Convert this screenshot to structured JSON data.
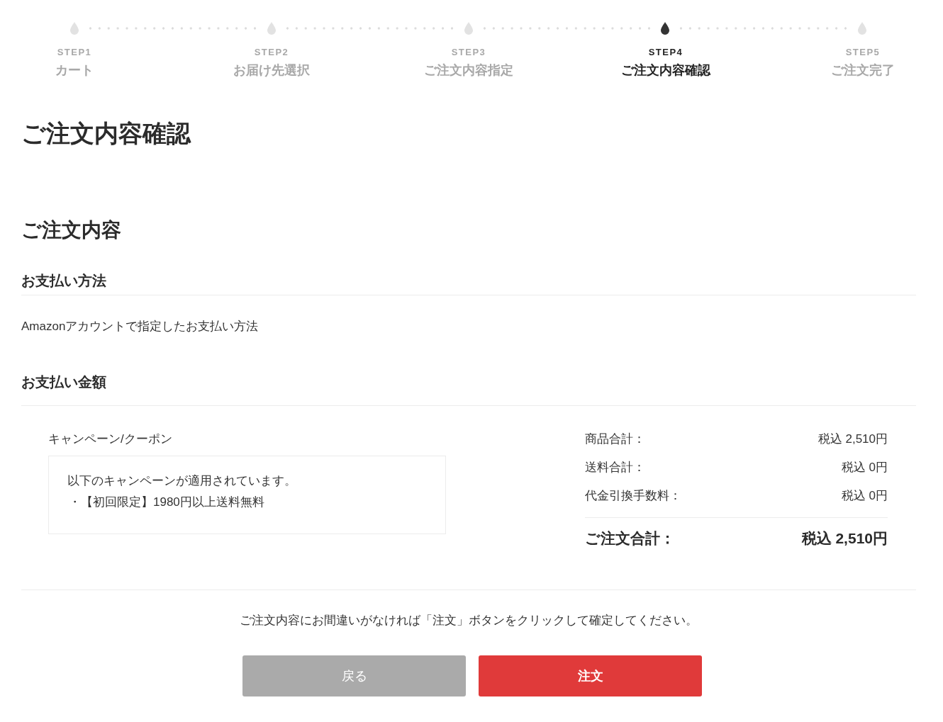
{
  "progress": {
    "steps": [
      {
        "label": "STEP1",
        "title": "カート",
        "selected": false
      },
      {
        "label": "STEP2",
        "title": "お届け先選択",
        "selected": false
      },
      {
        "label": "STEP3",
        "title": "ご注文内容指定",
        "selected": false
      },
      {
        "label": "STEP4",
        "title": "ご注文内容確認",
        "selected": true
      },
      {
        "label": "STEP5",
        "title": "ご注文完了",
        "selected": false
      }
    ]
  },
  "page_title": "ご注文内容確認",
  "order_details": {
    "heading": "ご注文内容",
    "payment_method": {
      "heading": "お支払い方法",
      "value": "Amazonアカウントで指定したお支払い方法"
    },
    "payment_amount": {
      "heading": "お支払い金額",
      "campaign": {
        "label": "キャンペーン/クーポン",
        "notice": "以下のキャンペーンが適用されています。",
        "items": [
          "・【初回限定】1980円以上送料無料"
        ]
      },
      "summary": {
        "rows": [
          {
            "label": "商品合計：",
            "value": "税込 2,510円"
          },
          {
            "label": "送料合計：",
            "value": "税込 0円"
          },
          {
            "label": "代金引換手数料：",
            "value": "税込 0円"
          }
        ],
        "total": {
          "label": "ご注文合計：",
          "value": "税込 2,510円"
        }
      }
    }
  },
  "confirm_note": "ご注文内容にお間違いがなければ「注文」ボタンをクリックして確定してください。",
  "buttons": [
    {
      "label": "戻る",
      "kind": "back"
    },
    {
      "label": "注文",
      "kind": "submit"
    }
  ]
}
